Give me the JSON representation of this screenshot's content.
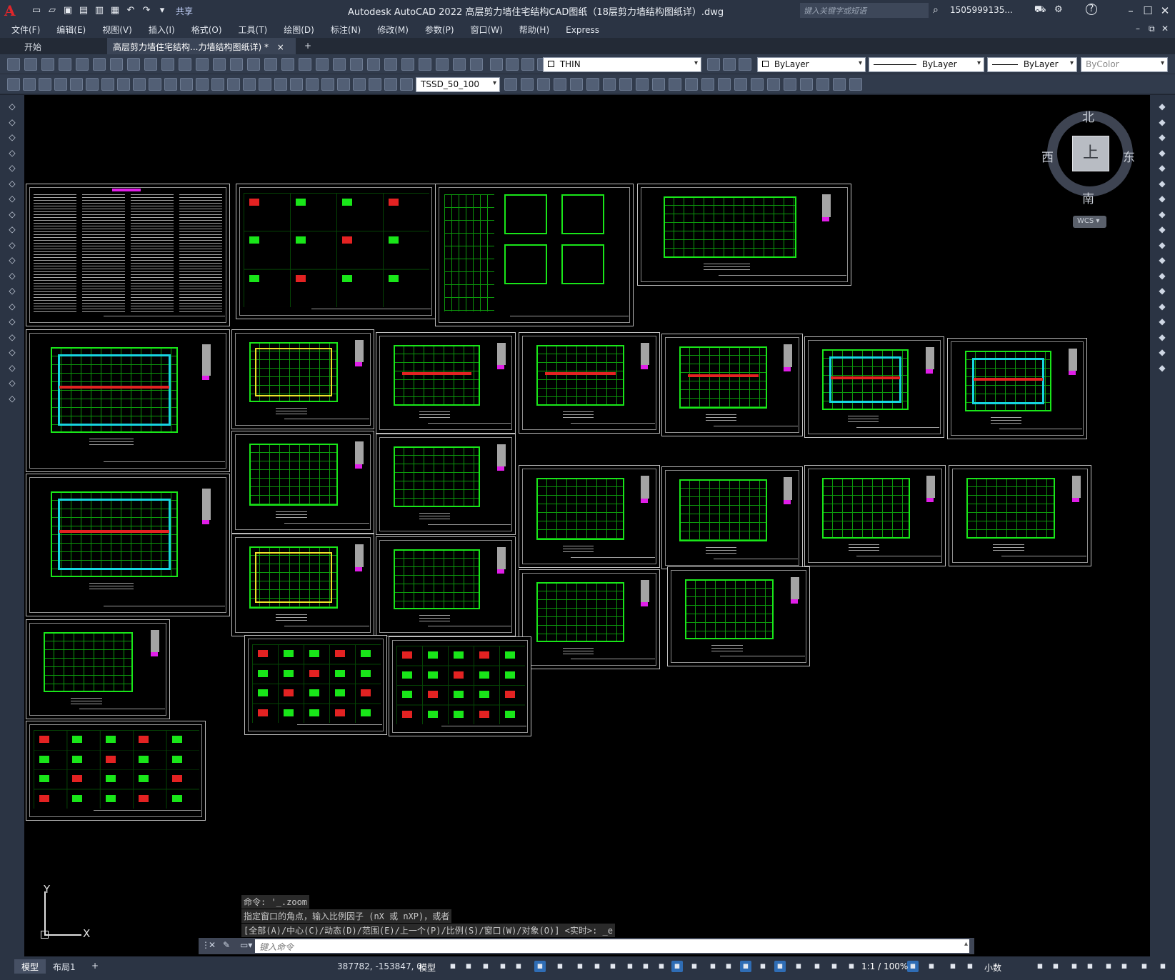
{
  "app": {
    "title": "Autodesk AutoCAD 2022    高层剪力墙住宅结构CAD图纸（18层剪力墙结构图纸详）.dwg",
    "logo": "A",
    "share_label": "共享",
    "search_placeholder": "键入关键字或短语",
    "user": "1505999135...",
    "help": "?"
  },
  "menu": [
    "文件(F)",
    "编辑(E)",
    "视图(V)",
    "插入(I)",
    "格式(O)",
    "工具(T)",
    "绘图(D)",
    "标注(N)",
    "修改(M)",
    "参数(P)",
    "窗口(W)",
    "帮助(H)",
    "Express"
  ],
  "tabs": {
    "start": "开始",
    "drawing": "高层剪力墙住宅结构...力墙结构图纸详)",
    "modified_marker": "*",
    "close": "×",
    "new": "+"
  },
  "toolbar": {
    "layer": "THIN",
    "color": "ByLayer",
    "linetype": "ByLayer",
    "lineweight": "ByLayer",
    "plotstyle": "ByColor",
    "dimstyle": "TSSD_50_100"
  },
  "viewcube": {
    "top": "上",
    "north": "北",
    "south": "南",
    "east": "东",
    "west": "西",
    "wcs": "WCS"
  },
  "ucs": {
    "x": "X",
    "y": "Y"
  },
  "command": {
    "history": [
      "命令: '_.zoom",
      "指定窗口的角点，输入比例因子 (nX 或 nXP)，或者",
      "[全部(A)/中心(C)/动态(D)/范围(E)/上一个(P)/比例(S)/窗口(W)/对象(O)] <实时>: _e"
    ],
    "placeholder": "键入命令"
  },
  "status": {
    "tab_model": "模型",
    "tab_layout": "布局1",
    "add": "+",
    "coords": "387782, -153847, 0",
    "mode": "模型",
    "scale": "1:1 / 100%",
    "units": "小数"
  },
  "colors": {
    "canvas": "#000000",
    "chrome": "#2b3444",
    "accent_blue": "#2f6db5",
    "plan_green": "#19e619",
    "wall_red": "#e32222",
    "wall_cyan": "#17d5e0"
  }
}
